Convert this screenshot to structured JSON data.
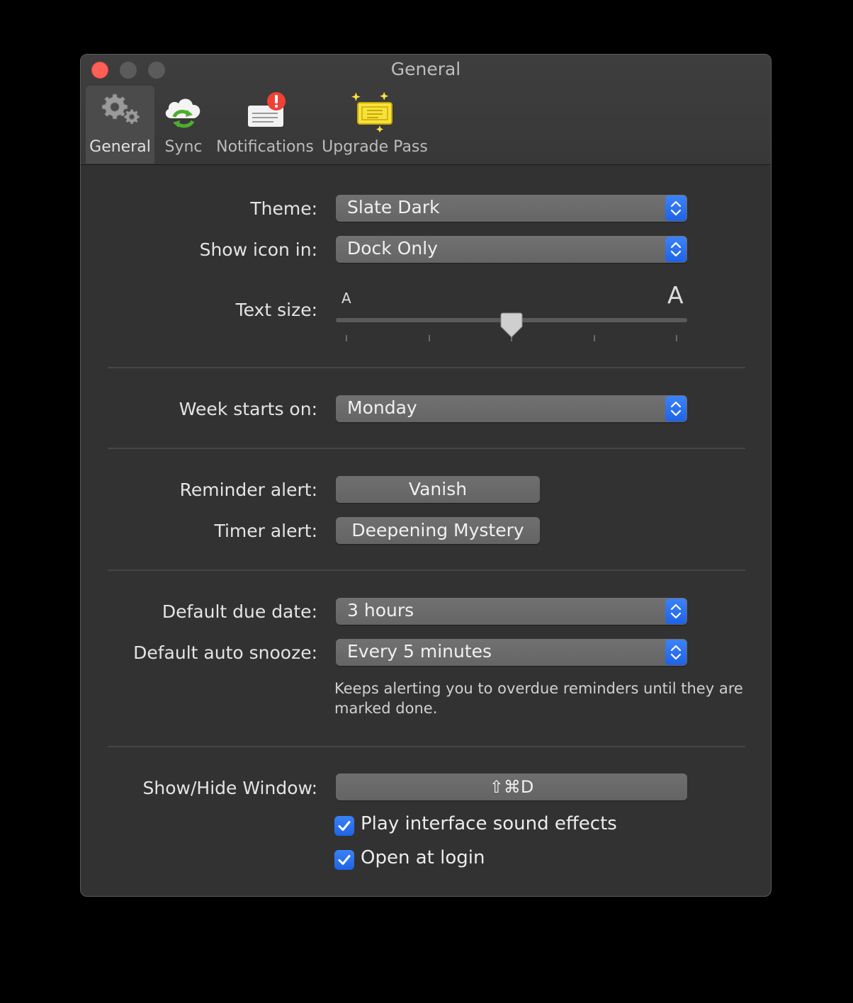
{
  "window": {
    "title": "General"
  },
  "toolbar": {
    "tabs": [
      {
        "label": "General",
        "icon": "gears-icon",
        "selected": true
      },
      {
        "label": "Sync",
        "icon": "cloud-sync-icon",
        "selected": false
      },
      {
        "label": "Notifications",
        "icon": "notification-badge-icon",
        "selected": false
      },
      {
        "label": "Upgrade Pass",
        "icon": "ticket-icon",
        "selected": false
      }
    ]
  },
  "settings": {
    "theme": {
      "label": "Theme:",
      "value": "Slate Dark"
    },
    "show_icon": {
      "label": "Show icon in:",
      "value": "Dock Only"
    },
    "text_size": {
      "label": "Text size:",
      "min_glyph": "A",
      "max_glyph": "A",
      "level": 0.5,
      "steps": 5
    },
    "week_start": {
      "label": "Week starts on:",
      "value": "Monday"
    },
    "reminder_alert": {
      "label": "Reminder alert:",
      "value": "Vanish"
    },
    "timer_alert": {
      "label": "Timer alert:",
      "value": "Deepening Mystery"
    },
    "default_due": {
      "label": "Default due date:",
      "value": "3 hours"
    },
    "auto_snooze": {
      "label": "Default auto snooze:",
      "value": "Every 5 minutes",
      "note": "Keeps alerting you to overdue reminders until they are marked done."
    },
    "show_hide": {
      "label": "Show/Hide Window:",
      "shortcut": "⇧⌘D"
    },
    "sound_effects": {
      "label": "Play interface sound effects",
      "checked": true
    },
    "open_login": {
      "label": "Open at login",
      "checked": true
    }
  },
  "colors": {
    "accent": "#2f74f0",
    "close": "#fe5f57",
    "window_bg": "#323232"
  }
}
